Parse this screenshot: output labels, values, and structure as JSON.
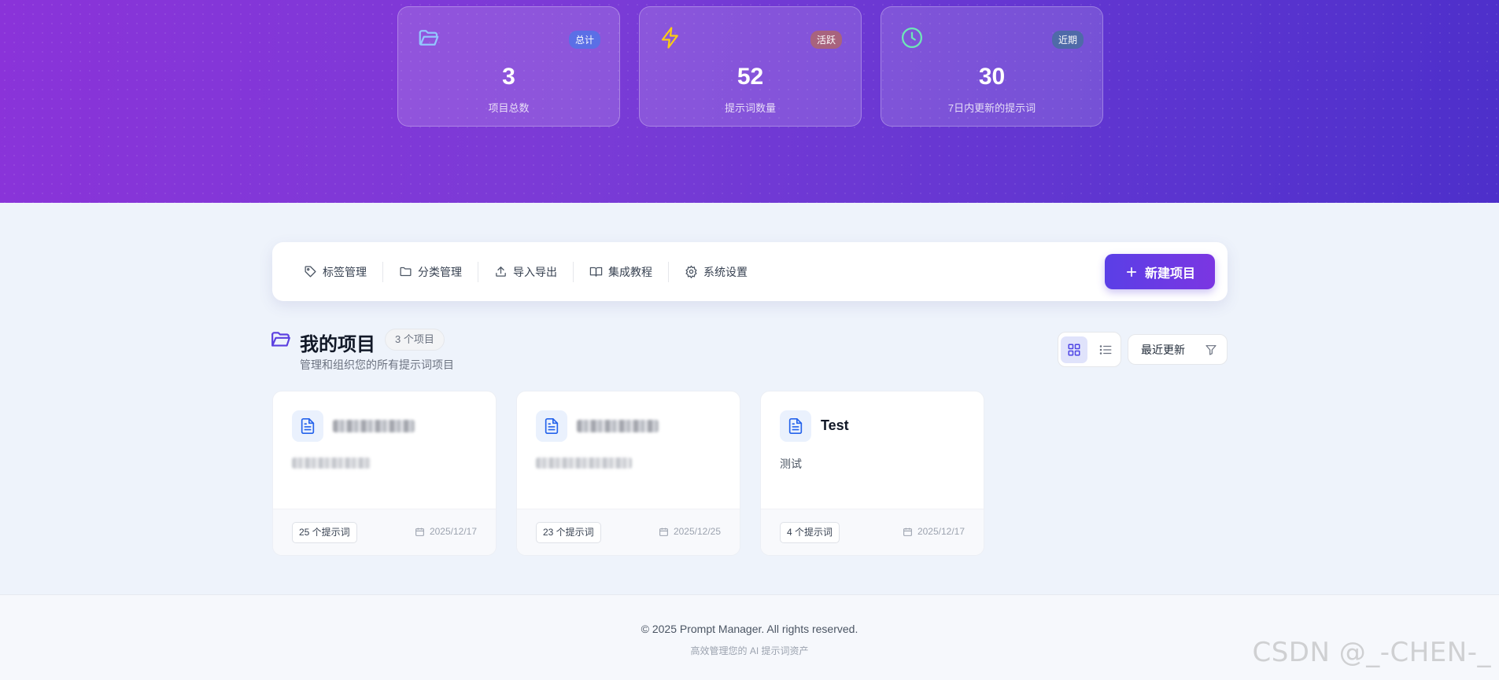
{
  "stats": [
    {
      "icon": "folder-open-icon",
      "badge": "总计",
      "value": "3",
      "label": "项目总数",
      "icon_color": "#93c5fd",
      "badge_bg": "#5b6fe6"
    },
    {
      "icon": "lightning-icon",
      "badge": "活跃",
      "value": "52",
      "label": "提示词数量",
      "icon_color": "#facc15",
      "badge_bg": "#a8637e"
    },
    {
      "icon": "clock-icon",
      "badge": "近期",
      "value": "30",
      "label": "7日内更新的提示词",
      "icon_color": "#6ee7b7",
      "badge_bg": "#4f6aa8"
    }
  ],
  "toolbar": {
    "items": [
      {
        "icon": "tag-icon",
        "label": "标签管理"
      },
      {
        "icon": "folder-icon",
        "label": "分类管理"
      },
      {
        "icon": "upload-icon",
        "label": "导入导出"
      },
      {
        "icon": "book-icon",
        "label": "集成教程"
      },
      {
        "icon": "gear-icon",
        "label": "系统设置"
      }
    ],
    "new_button": "新建项目"
  },
  "section": {
    "title": "我的项目",
    "count": "3 个项目",
    "subtitle": "管理和组织您的所有提示词项目",
    "sort": "最近更新",
    "view_mode": "grid"
  },
  "projects": [
    {
      "title": "",
      "description": "",
      "prompts": "25 个提示词",
      "date": "2025/12/17",
      "blurred": true
    },
    {
      "title": "",
      "description": "",
      "prompts": "23 个提示词",
      "date": "2025/12/25",
      "blurred": true
    },
    {
      "title": "Test",
      "description": "测试",
      "prompts": "4 个提示词",
      "date": "2025/12/17",
      "blurred": false
    }
  ],
  "footer": {
    "copyright": "© 2025 Prompt Manager. All rights reserved.",
    "tagline": "高效管理您的 AI 提示词资产"
  },
  "watermark": "CSDN @_-CHEN-_"
}
